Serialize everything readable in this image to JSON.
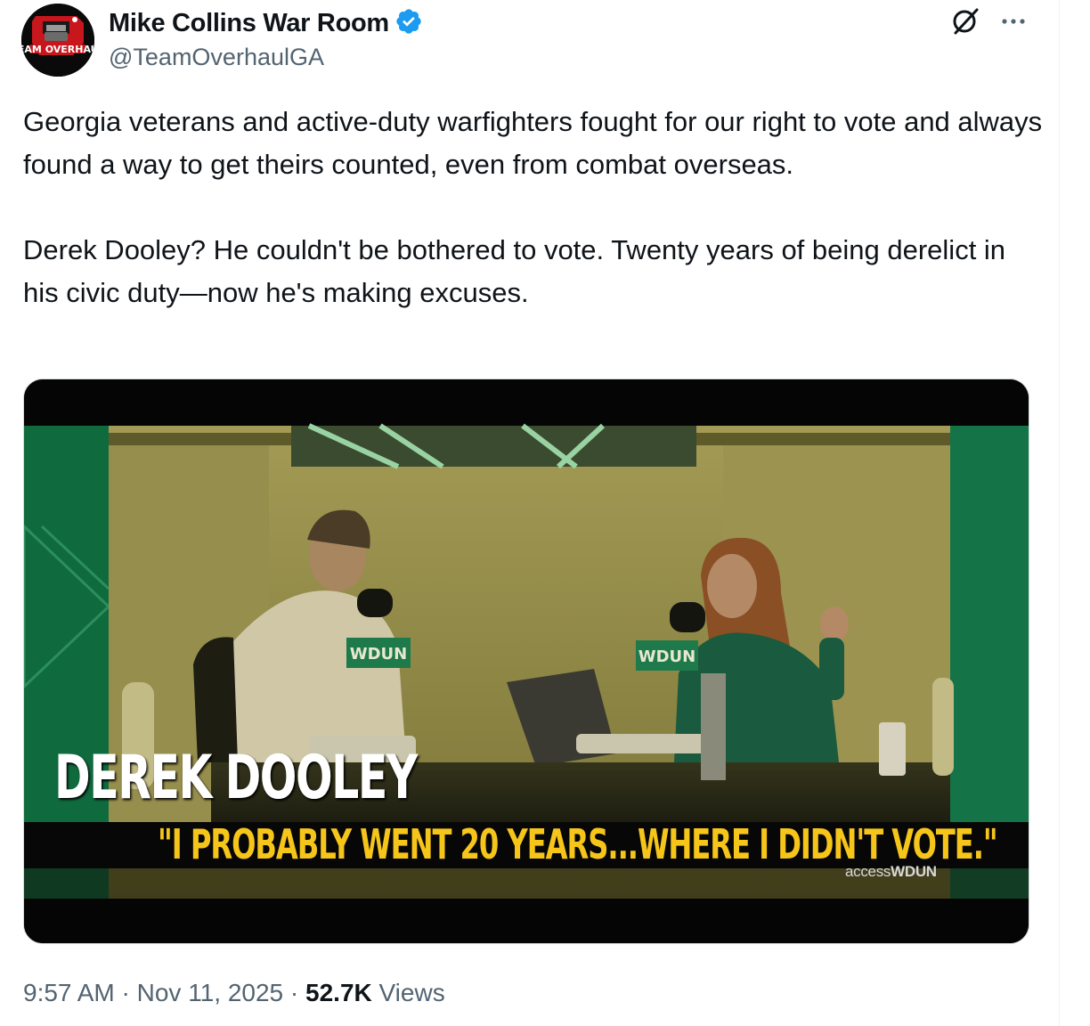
{
  "author": {
    "display_name": "Mike Collins War Room",
    "handle": "@TeamOverhaulGA",
    "verified": true,
    "avatar_text": "TEAM OVERHAUL"
  },
  "header_icons": {
    "grok": "grok-slash-circle-icon",
    "more": "more-dots-icon"
  },
  "tweet": {
    "text": "Georgia veterans and active-duty warfighters fought for our right to vote and always found a way to get theirs counted, even from combat overseas.\n\nDerek Dooley? He couldn't be bothered to vote. Twenty years of being derelict in his civic duty—now he's making excuses."
  },
  "media": {
    "overlay_name": "DEREK DOOLEY",
    "caption": "\"I PROBABLY WENT 20 YEARS...WHERE I DIDN'T VOTE.\"",
    "watermark_prefix": "access",
    "watermark_brand": "WDUN",
    "mic_flag_text": "WDUN"
  },
  "meta": {
    "time": "9:57 AM",
    "separator": "·",
    "date": "Nov 11, 2025",
    "views_count": "52.7K",
    "views_label": "Views"
  },
  "colors": {
    "verified_blue": "#1d9bf0",
    "secondary_text": "#536471",
    "caption_yellow": "#f6c51a",
    "studio_green": "#0f6b3e"
  }
}
